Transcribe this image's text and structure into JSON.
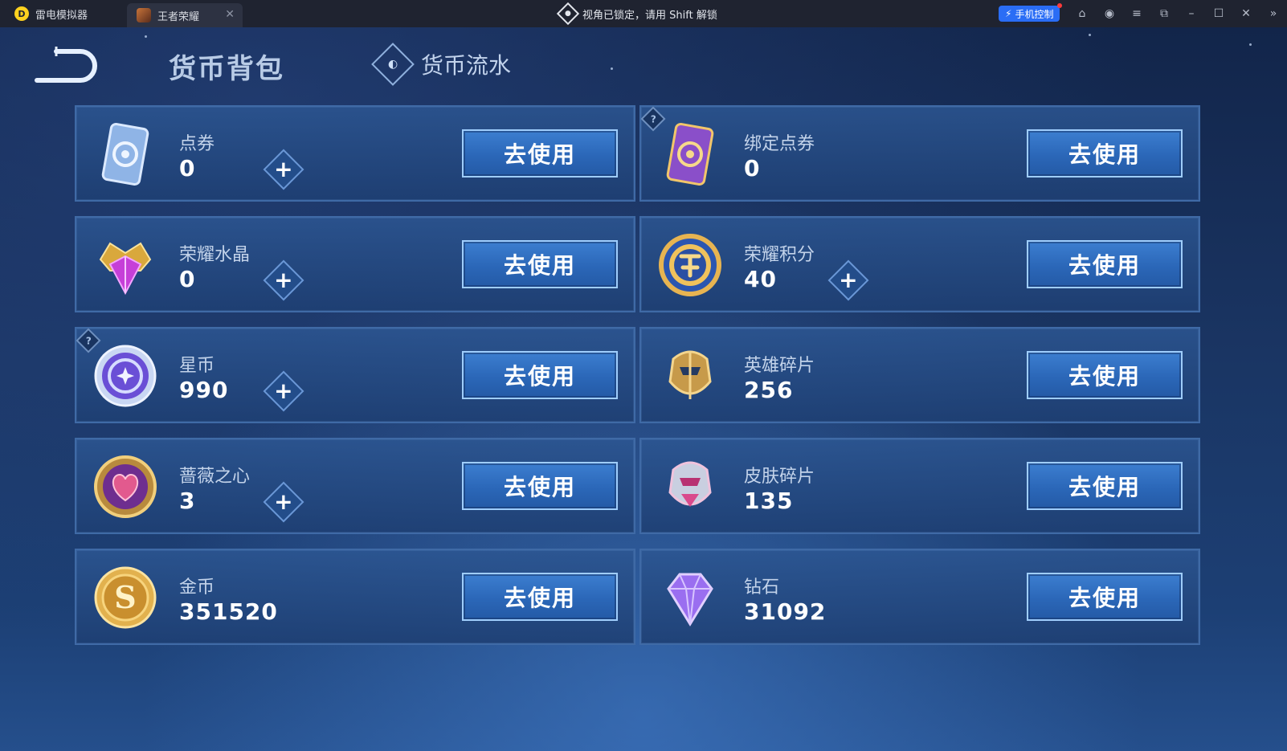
{
  "window": {
    "launcher_tab": "雷电模拟器",
    "game_tab": "王者荣耀",
    "lock_status": "视角已锁定，请用 Shift 解锁",
    "phone_control": "手机控制"
  },
  "page": {
    "title": "货币背包",
    "ledger_tab": "货币流水",
    "use_label": "去使用"
  },
  "currencies": [
    {
      "name": "点券",
      "amount": "0",
      "icon": "coupon-card-icon"
    },
    {
      "name": "绑定点券",
      "amount": "0",
      "icon": "bound-coupon-card-icon"
    },
    {
      "name": "荣耀水晶",
      "amount": "0",
      "icon": "glory-crystal-icon"
    },
    {
      "name": "荣耀积分",
      "amount": "40",
      "icon": "glory-points-icon"
    },
    {
      "name": "星币",
      "amount": "990",
      "icon": "star-coin-icon"
    },
    {
      "name": "英雄碎片",
      "amount": "256",
      "icon": "hero-fragment-icon"
    },
    {
      "name": "蔷薇之心",
      "amount": "3",
      "icon": "rose-heart-icon"
    },
    {
      "name": "皮肤碎片",
      "amount": "135",
      "icon": "skin-fragment-icon"
    },
    {
      "name": "金币",
      "amount": "351520",
      "icon": "gold-coin-icon"
    },
    {
      "name": "钻石",
      "amount": "31092",
      "icon": "diamond-icon"
    }
  ],
  "colors": {
    "button_blue": "#2b67b8",
    "card_border": "#3f6aa6",
    "accent_blue": "#2a6df5"
  }
}
